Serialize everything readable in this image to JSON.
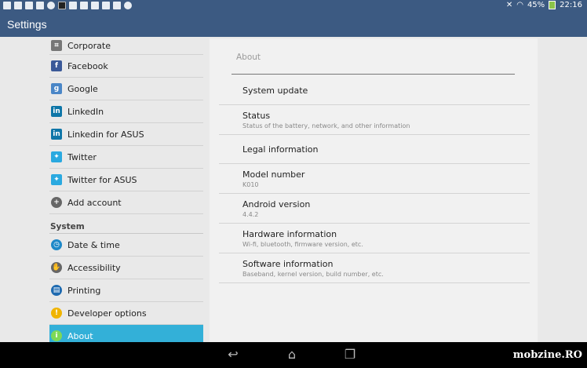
{
  "status_bar": {
    "battery": "45%",
    "time": "22:16"
  },
  "action_bar": {
    "title": "Settings"
  },
  "sidebar": {
    "accounts": [
      {
        "label": "Corporate",
        "icon": "corporate-icon",
        "color": "#777777"
      },
      {
        "label": "Facebook",
        "icon": "facebook-icon",
        "color": "#3b5998"
      },
      {
        "label": "Google",
        "icon": "google-icon",
        "color": "#4a86c7"
      },
      {
        "label": "LinkedIn",
        "icon": "linkedin-icon",
        "color": "#0e76a8"
      },
      {
        "label": "Linkedin for ASUS",
        "icon": "linkedin-icon",
        "color": "#0e76a8"
      },
      {
        "label": "Twitter",
        "icon": "twitter-icon",
        "color": "#2aa9e0"
      },
      {
        "label": "Twitter for ASUS",
        "icon": "twitter-icon",
        "color": "#2aa9e0"
      },
      {
        "label": "Add account",
        "icon": "add-icon",
        "color": "#666666"
      }
    ],
    "system_header": "System",
    "system": [
      {
        "label": "Date & time",
        "icon": "clock-icon",
        "color": "#1e88c8"
      },
      {
        "label": "Accessibility",
        "icon": "accessibility-icon",
        "color": "#666666"
      },
      {
        "label": "Printing",
        "icon": "printer-icon",
        "color": "#1e6ab0"
      },
      {
        "label": "Developer options",
        "icon": "developer-icon",
        "color": "#f0b400"
      },
      {
        "label": "About",
        "icon": "info-icon",
        "color": "#7ed957",
        "selected": true
      }
    ]
  },
  "about": {
    "header": "About",
    "items": [
      {
        "title": "System update",
        "subtitle": ""
      },
      {
        "title": "Status",
        "subtitle": "Status of the battery, network, and other information"
      },
      {
        "title": "Legal information",
        "subtitle": ""
      },
      {
        "title": "Model number",
        "subtitle": "K010"
      },
      {
        "title": "Android version",
        "subtitle": "4.4.2"
      },
      {
        "title": "Hardware information",
        "subtitle": "Wi-fi, bluetooth, firmware version, etc."
      },
      {
        "title": "Software information",
        "subtitle": "Baseband, kernel version, build number, etc."
      }
    ]
  },
  "navbar": {
    "watermark": "mobzine.RO"
  },
  "colors": {
    "bar": "#3c5a82",
    "selected": "#33b0d8"
  }
}
